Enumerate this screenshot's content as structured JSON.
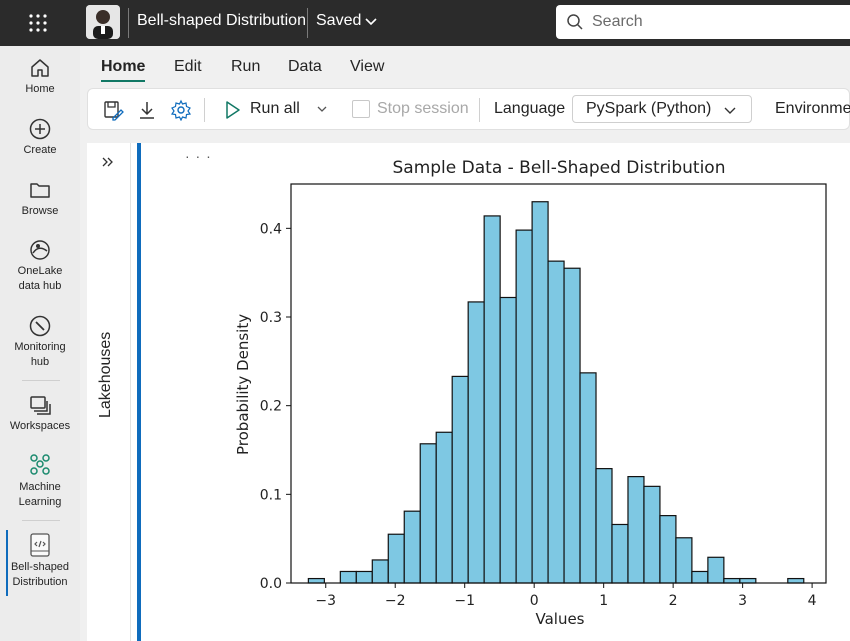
{
  "topbar": {
    "doc_title": "Bell-shaped Distribution",
    "saved_label": "Saved",
    "search_placeholder": "Search"
  },
  "rail": {
    "items": [
      {
        "label": "Home",
        "icon": "home-icon"
      },
      {
        "label": "Create",
        "icon": "plus-circle-icon"
      },
      {
        "label": "Browse",
        "icon": "folder-icon"
      },
      {
        "label": "OneLake\ndata hub",
        "icon": "onelake-icon"
      },
      {
        "label": "Monitoring\nhub",
        "icon": "monitoring-icon"
      },
      {
        "label": "Workspaces",
        "icon": "workspaces-icon"
      },
      {
        "label": "Machine\nLearning",
        "icon": "machine-learning-icon"
      },
      {
        "label": "Bell-shaped\nDistribution",
        "icon": "notebook-icon"
      }
    ]
  },
  "ribbon": {
    "tabs": [
      "Home",
      "Edit",
      "Run",
      "Data",
      "View"
    ],
    "active_tab": "Home",
    "run_all_label": "Run all",
    "stop_session_label": "Stop session",
    "language_label": "Language",
    "language_value": "PySpark (Python)",
    "environment_label": "Environmen"
  },
  "lakehouse_panel": {
    "label": "Lakehouses"
  },
  "colors": {
    "bar_fill": "#7ec8e3",
    "bar_edge": "#111111",
    "accent": "#0f6cbd",
    "active_tab_underline": "#117865"
  },
  "chart_data": {
    "type": "bar",
    "title": "Sample Data - Bell-Shaped Distribution",
    "xlabel": "Values",
    "ylabel": "Probability Density",
    "xlim": [
      -3.5,
      4.2
    ],
    "ylim": [
      0,
      0.45
    ],
    "xticks": [
      -3,
      -2,
      -1,
      0,
      1,
      2,
      3,
      4
    ],
    "yticks": [
      0.0,
      0.1,
      0.2,
      0.3,
      0.4
    ],
    "bin_edges": [
      -3.25,
      -3.02,
      -2.79,
      -2.56,
      -2.33,
      -2.1,
      -1.87,
      -1.64,
      -1.41,
      -1.18,
      -0.95,
      -0.72,
      -0.49,
      -0.26,
      -0.03,
      0.2,
      0.43,
      0.66,
      0.89,
      1.12,
      1.35,
      1.58,
      1.81,
      2.04,
      2.27,
      2.5,
      2.73,
      2.96,
      3.19,
      3.42,
      3.65,
      3.88
    ],
    "values": [
      0.005,
      0.0,
      0.013,
      0.013,
      0.026,
      0.055,
      0.081,
      0.157,
      0.17,
      0.233,
      0.317,
      0.414,
      0.322,
      0.398,
      0.43,
      0.363,
      0.355,
      0.237,
      0.129,
      0.066,
      0.12,
      0.109,
      0.076,
      0.051,
      0.013,
      0.029,
      0.005,
      0.005,
      0.0,
      0.0,
      0.005
    ],
    "grid": false
  }
}
